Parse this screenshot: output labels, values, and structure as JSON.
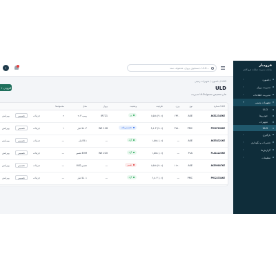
{
  "sidebar": {
    "brand_title": "فرودبار",
    "brand_sub": "سامانه مدیریت عملیات فرودگاهی",
    "items": [
      {
        "label": "داشبورد",
        "active": false,
        "sub": false
      },
      {
        "label": "مدیریت پرواز",
        "active": false,
        "sub": false
      },
      {
        "label": "مدیریت اطلاعات",
        "active": false,
        "sub": false
      },
      {
        "label": "تجهیزات زمینی",
        "active": true,
        "sub": false
      },
      {
        "label": "ULD",
        "active": false,
        "sub": true
      },
      {
        "label": "خودروها",
        "active": false,
        "sub": true
      },
      {
        "label": "تجهیزات",
        "active": false,
        "sub": true
      },
      {
        "label": "ULD",
        "active": false,
        "sub": true,
        "sub_active": true
      },
      {
        "label": "بارگیری",
        "active": false,
        "sub": false
      },
      {
        "label": "تعمیرات و نگهداری",
        "active": false,
        "sub": false
      },
      {
        "label": "گزارش‌ها",
        "active": false,
        "sub": false
      },
      {
        "label": "تنظیمات",
        "active": false,
        "sub": false
      }
    ]
  },
  "topbar": {
    "search_placeholder": "جستجوی پرواز، محموله، سند، ULD...",
    "avatar_initial": "ا"
  },
  "content": {
    "breadcrumb": "داشبورد / تجهیزات زمینی / ULD",
    "title": "ULD",
    "subtitle": "مدیریت ULDها و تخصیص محموله",
    "add_button": "+ افزودن"
  },
  "table": {
    "headers": [
      "شماره ULD",
      "نوع",
      "وزن",
      "ظرفیت",
      "وضعیت",
      "پرواز",
      "محل",
      "محموله‌ها",
      "",
      ""
    ],
    "rows": [
      {
        "id": "AKE12345KE",
        "type": "AKE",
        "weight": "۱۴۳۰",
        "capacity": "۱,۵۸۸ (۹۰٪)",
        "status": "پر",
        "status_color": "#16a34a",
        "status_bg": "#e8f7ee",
        "flight": "IR721",
        "location": "رمپ ۲۰۳",
        "cargo": "۲"
      },
      {
        "id": "PMC67890KE",
        "type": "PMC",
        "weight": "۴۷۸۰",
        "capacity": "۶,۸۰۴ (۷۰٪)",
        "status": "تخصیص‌یافته",
        "status_color": "#2563eb",
        "status_bg": "#e8f0fd",
        "flight": "W5 118",
        "location": "انبار A-۰۳",
        "cargo": "۱"
      },
      {
        "id": "AKE54321KE",
        "type": "AKE",
        "weight": "—",
        "capacity": "۱,۵۸۸ (۰٪)",
        "status": "آزاد",
        "status_color": "#16a34a",
        "status_bg": "#e8f7ee",
        "flight": "—",
        "location": "انبار B-۱",
        "cargo": "—"
      },
      {
        "id": "PLA11223KE",
        "type": "PLA",
        "weight": "—",
        "capacity": "۱,۵۸۸ (۰٪)",
        "status": "آزاد",
        "status_color": "#16a34a",
        "status_bg": "#e8f7ee",
        "flight": "W5 220",
        "location": "تعمیر EVM",
        "cargo": "—"
      },
      {
        "id": "AKE99887KE",
        "type": "AKE",
        "weight": "۱۱۲۰",
        "capacity": "۱,۵۸۸ (۷۰٪)",
        "status": "تعمیر",
        "status_color": "#dc2626",
        "status_bg": "#fdecec",
        "flight": "—",
        "location": "ULD تعمیر",
        "cargo": "—"
      },
      {
        "id": "PMC22334KE",
        "type": "PMC",
        "weight": "—",
        "capacity": "۶,۸۰۴ (۰٪)",
        "status": "آزاد",
        "status_color": "#16a34a",
        "status_bg": "#e8f7ee",
        "flight": "—",
        "location": "انبار A-۰۱",
        "cargo": "—"
      }
    ],
    "action_details": "جزئیات",
    "action_assign": "تخصیص",
    "action_edit": "ویرایش"
  }
}
